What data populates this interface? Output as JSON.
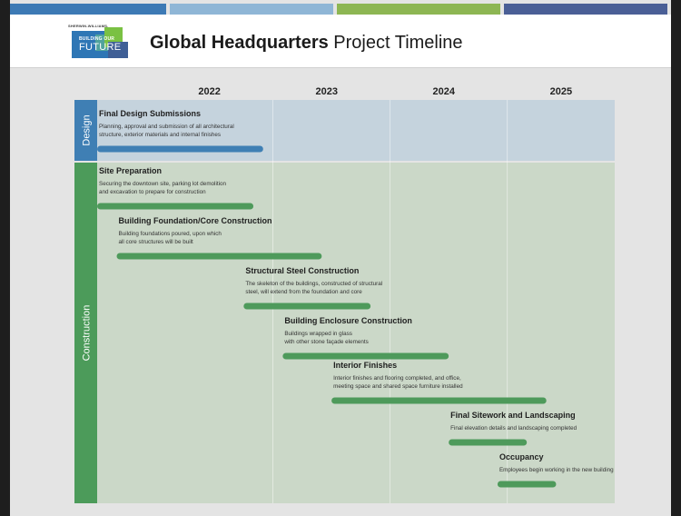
{
  "brand": {
    "company": "SHERWIN-WILLIAMS.",
    "tagline_top": "BUILDING OUR",
    "tagline_bottom": "FUTURE"
  },
  "header": {
    "title_bold": "Global Headquarters",
    "title_rest": "Project Timeline",
    "stripe_colors": [
      "#3d7ab5",
      "#8fb6d6",
      "#8db653",
      "#4a5f96"
    ]
  },
  "colors": {
    "design_band": "#c5d3dd",
    "construction_band": "#cbd8c8",
    "design_label_bg": "#3f7fb4",
    "construction_label_bg": "#4c9b5a",
    "design_bar": "#3f7fb4",
    "construction_bar": "#4e9a5b"
  },
  "chart_data": {
    "type": "gantt",
    "x_axis": {
      "ticks": [
        "2022",
        "2023",
        "2024",
        "2025"
      ],
      "range": [
        "2021-07",
        "2025-12"
      ]
    },
    "grid": true,
    "phases": [
      {
        "name": "Design",
        "tasks": [
          0
        ]
      },
      {
        "name": "Construction",
        "tasks": [
          1,
          2,
          3,
          4,
          5,
          6,
          7
        ]
      }
    ],
    "tasks": [
      {
        "name": "Final Design Submissions",
        "phase": "Design",
        "description": [
          "Planning, approval and submission of all architectural",
          "structure, exterior materials and internal finishes"
        ],
        "start": "2021-07",
        "end": "2022-12"
      },
      {
        "name": "Site Preparation",
        "phase": "Construction",
        "description": [
          "Securing the downtown site, parking lot demolition",
          "and excavation to prepare for construction"
        ],
        "start": "2021-07",
        "end": "2022-11"
      },
      {
        "name": "Building Foundation/Core Construction",
        "phase": "Construction",
        "description": [
          "Building foundations poured, upon which",
          "all core structures will be built"
        ],
        "start": "2021-09",
        "end": "2023-06"
      },
      {
        "name": "Structural Steel Construction",
        "phase": "Construction",
        "description": [
          "The skeleton of the buildings, constructed of structural",
          "steel, will extend from the foundation and core"
        ],
        "start": "2022-10",
        "end": "2023-11"
      },
      {
        "name": "Building Enclosure Construction",
        "phase": "Construction",
        "description": [
          "Buildings wrapped in glass",
          "with other stone façade elements"
        ],
        "start": "2023-02",
        "end": "2024-07"
      },
      {
        "name": "Interior Finishes",
        "phase": "Construction",
        "description": [
          "Interior finishes and flooring completed, and office,",
          "meeting space and shared space furniture installed"
        ],
        "start": "2023-07",
        "end": "2025-05"
      },
      {
        "name": "Final Sitework and Landscaping",
        "phase": "Construction",
        "description": [
          "Final elevation details and landscaping completed"
        ],
        "start": "2024-07",
        "end": "2025-03"
      },
      {
        "name": "Occupancy",
        "phase": "Construction",
        "description": [
          "Employees begin working in the new building"
        ],
        "start": "2024-12",
        "end": "2025-06"
      }
    ]
  }
}
